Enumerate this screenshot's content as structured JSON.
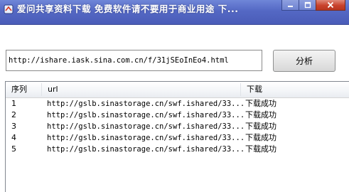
{
  "window": {
    "title": "爱问共享资料下载  免费软件请不要用于商业用途  下...",
    "buttons": [
      "minimize",
      "maximize",
      "close"
    ]
  },
  "url_input": {
    "value": "http://ishare.iask.sina.com.cn/f/31jSEoInEo4.html"
  },
  "analyze_button": {
    "label": "分析"
  },
  "list": {
    "columns": {
      "index": "序列",
      "url": "url",
      "status": "下载"
    },
    "rows": [
      {
        "index": "1",
        "url": "http://gslb.sinastorage.cn/swf.ishared/33...",
        "status": "下载成功"
      },
      {
        "index": "2",
        "url": "http://gslb.sinastorage.cn/swf.ishared/33...",
        "status": "下载成功"
      },
      {
        "index": "3",
        "url": "http://gslb.sinastorage.cn/swf.ishared/33...",
        "status": "下载成功"
      },
      {
        "index": "4",
        "url": "http://gslb.sinastorage.cn/swf.ishared/33...",
        "status": "下载成功"
      },
      {
        "index": "5",
        "url": "http://gslb.sinastorage.cn/swf.ishared/33...",
        "status": "下载成功"
      }
    ]
  },
  "colors": {
    "titlebar": "#5468c4",
    "close_button": "#c8422c",
    "header": "#f3f5f8"
  }
}
